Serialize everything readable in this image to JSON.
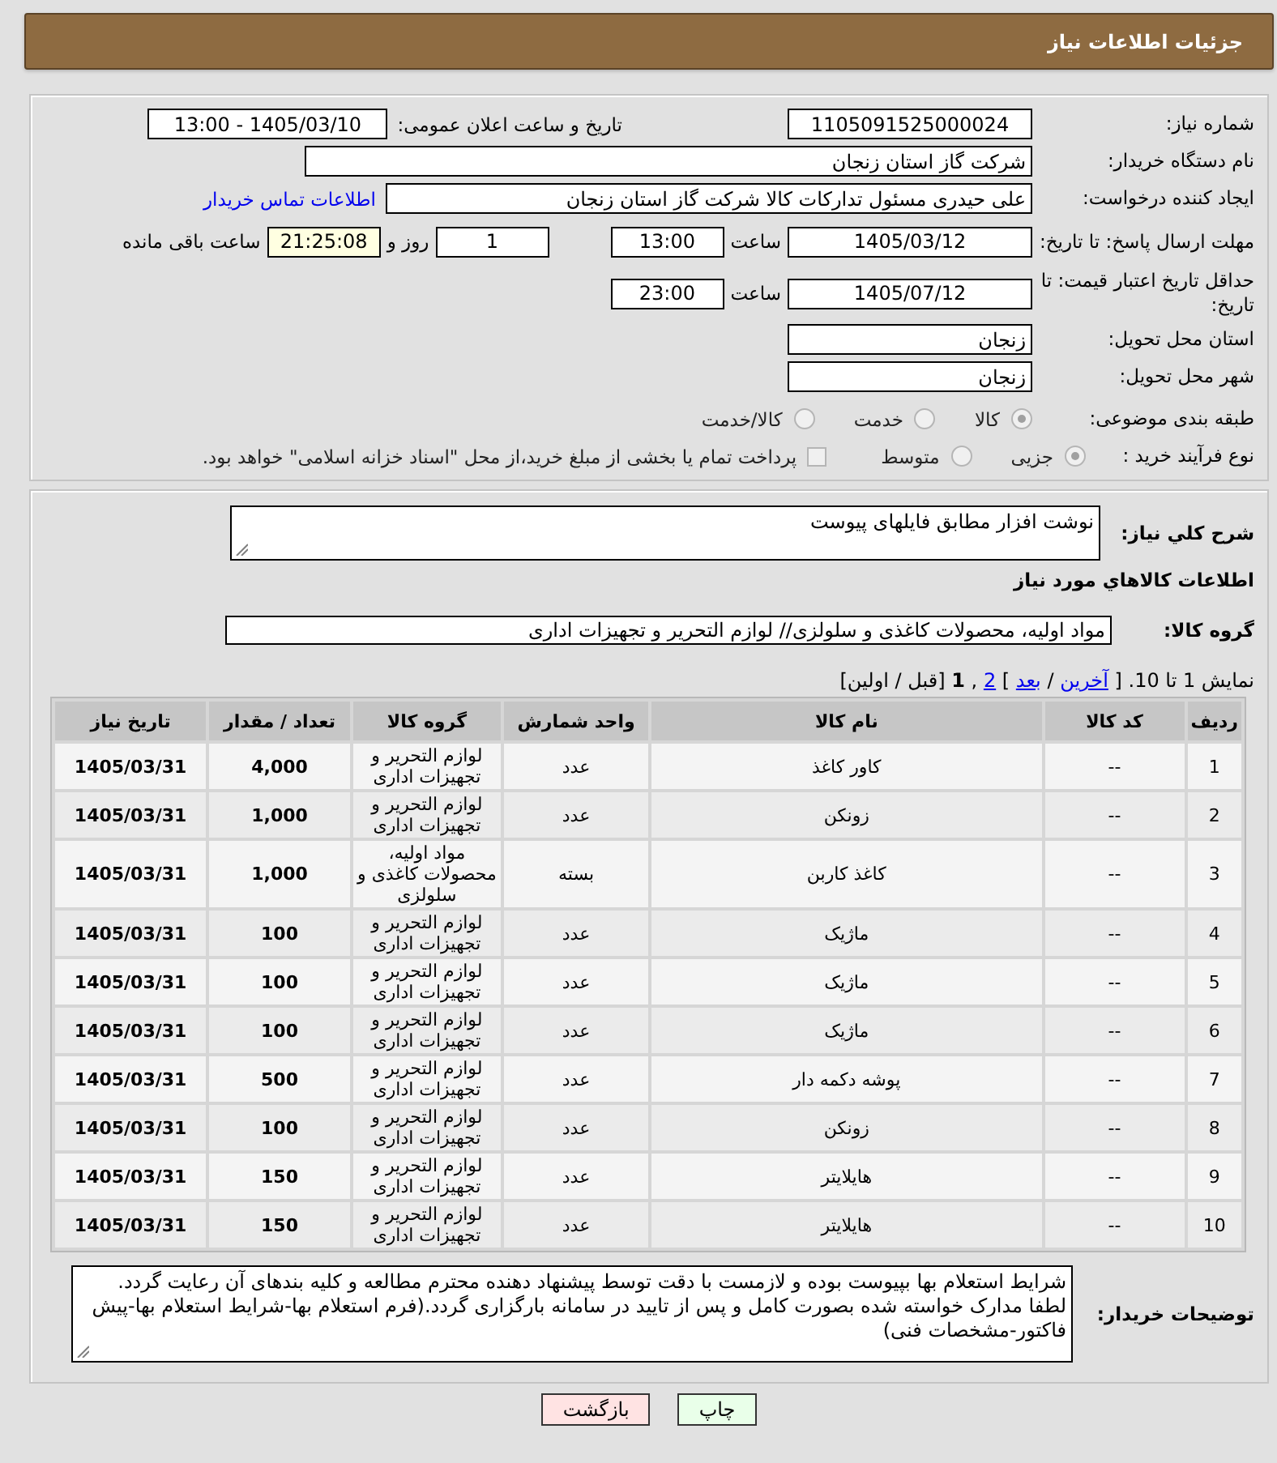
{
  "header": {
    "title": "جزئیات اطلاعات نیاز"
  },
  "need_number": {
    "label": "شماره نیاز:",
    "value": "1105091525000024"
  },
  "announce": {
    "label": "تاریخ و ساعت اعلان عمومی:",
    "value": "1405/03/10 - 13:00"
  },
  "buyer_org": {
    "label": "نام دستگاه خریدار:",
    "value": "شرکت گاز استان زنجان"
  },
  "requester": {
    "label": "ایجاد کننده درخواست:",
    "value": "علی حیدری مسئول تدارکات کالا شرکت گاز استان زنجان",
    "link": "اطلاعات تماس خریدار"
  },
  "response_deadline": {
    "label": "مهلت ارسال پاسخ: تا تاریخ:",
    "date": "1405/03/12",
    "time_label": "ساعت",
    "time": "13:00",
    "days": "1",
    "days_label": "روز و",
    "remaining": "21:25:08",
    "remaining_label": "ساعت باقی مانده"
  },
  "price_validity": {
    "label": "حداقل تاریخ اعتبار قیمت: تا تاریخ:",
    "date": "1405/07/12",
    "time_label": "ساعت",
    "time": "23:00"
  },
  "province": {
    "label": "استان محل تحویل:",
    "value": "زنجان"
  },
  "city": {
    "label": "شهر محل تحویل:",
    "value": "زنجان"
  },
  "category": {
    "label": "طبقه بندی موضوعی:",
    "options": [
      {
        "label": "کالا",
        "selected": true
      },
      {
        "label": "خدمت",
        "selected": false
      },
      {
        "label": "کالا/خدمت",
        "selected": false
      }
    ]
  },
  "purchase_type": {
    "label": "نوع فرآیند خرید :",
    "options": [
      {
        "label": "جزیی",
        "selected": true
      },
      {
        "label": "متوسط",
        "selected": false
      }
    ],
    "treasury": {
      "label": "پرداخت تمام یا بخشی از مبلغ خرید،از محل \"اسناد خزانه اسلامی\" خواهد بود.",
      "checked": false
    }
  },
  "description": {
    "label": "شرح كلي نياز:",
    "value": "نوشت افزار مطابق فایلهای پیوست"
  },
  "goods_heading": "اطلاعات كالاهاي مورد نياز",
  "goods_group": {
    "label": "گروه کالا:",
    "value": "مواد اولیه، محصولات کاغذی و سلولزی// لوازم التحریر و تجهیزات اداری"
  },
  "pager": {
    "parts": [
      {
        "text": "نمایش 1 تا 10. [",
        "kind": "text"
      },
      {
        "text": "آخرین",
        "kind": "link"
      },
      {
        "text": "/",
        "kind": "text"
      },
      {
        "text": "بعد",
        "kind": "link"
      },
      {
        "text": "]",
        "kind": "text"
      },
      {
        "text": "2",
        "kind": "link"
      },
      {
        "text": ",",
        "kind": "text"
      },
      {
        "text": "1",
        "kind": "current"
      },
      {
        "text": "[قبل / اولین]",
        "kind": "text"
      }
    ]
  },
  "table": {
    "columns": [
      "ردیف",
      "کد کالا",
      "نام کالا",
      "واحد شمارش",
      "گروه کالا",
      "تعداد / مقدار",
      "تاریخ نیاز"
    ],
    "rows": [
      [
        "1",
        "--",
        "کاور کاغذ",
        "عدد",
        "لوازم التحریر و تجهیزات اداری",
        "4,000",
        "1405/03/31"
      ],
      [
        "2",
        "--",
        "زونکن",
        "عدد",
        "لوازم التحریر و تجهیزات اداری",
        "1,000",
        "1405/03/31"
      ],
      [
        "3",
        "--",
        "کاغذ کاربن",
        "بسته",
        "مواد اولیه، محصولات کاغذی و سلولزی",
        "1,000",
        "1405/03/31"
      ],
      [
        "4",
        "--",
        "ماژیک",
        "عدد",
        "لوازم التحریر و تجهیزات اداری",
        "100",
        "1405/03/31"
      ],
      [
        "5",
        "--",
        "ماژیک",
        "عدد",
        "لوازم التحریر و تجهیزات اداری",
        "100",
        "1405/03/31"
      ],
      [
        "6",
        "--",
        "ماژیک",
        "عدد",
        "لوازم التحریر و تجهیزات اداری",
        "100",
        "1405/03/31"
      ],
      [
        "7",
        "--",
        "پوشه دکمه دار",
        "عدد",
        "لوازم التحریر و تجهیزات اداری",
        "500",
        "1405/03/31"
      ],
      [
        "8",
        "--",
        "زونکن",
        "عدد",
        "لوازم التحریر و تجهیزات اداری",
        "100",
        "1405/03/31"
      ],
      [
        "9",
        "--",
        "هایلایتر",
        "عدد",
        "لوازم التحریر و تجهیزات اداری",
        "150",
        "1405/03/31"
      ],
      [
        "10",
        "--",
        "هایلایتر",
        "عدد",
        "لوازم التحریر و تجهیزات اداری",
        "150",
        "1405/03/31"
      ]
    ]
  },
  "buyer_notes": {
    "label": "توضیحات خریدار:",
    "paragraphs": [
      "شرایط استعلام بها بپیوست بوده و لازمست با دقت توسط پیشنهاد دهنده محترم مطالعه و کلیه بندهای آن رعایت گردد.",
      "لطفا مدارک خواسته شده بصورت کامل و پس از تایید در سامانه بارگزاری گردد.(فرم استعلام بها-شرایط استعلام بها-پیش فاکتور-مشخصات فنی)"
    ]
  },
  "buttons": [
    {
      "label": "چاپ",
      "kind": "print"
    },
    {
      "label": "بازگشت",
      "kind": "back"
    }
  ]
}
